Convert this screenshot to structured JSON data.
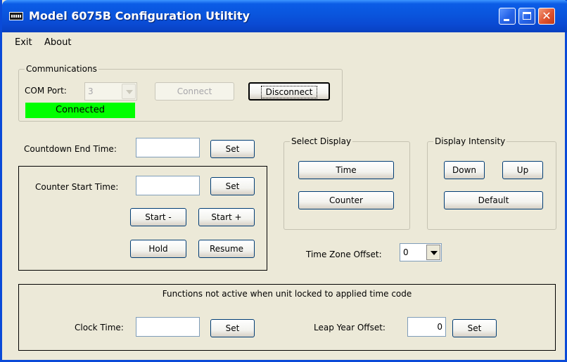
{
  "window": {
    "title": "Model 6075B Configuration Utiltity",
    "icon": "app-logo-icon"
  },
  "menu": {
    "items": [
      "Exit",
      "About"
    ]
  },
  "communications": {
    "group_label": "Communications",
    "com_port_label": "COM Port:",
    "com_port_value": "3",
    "connect_label": "Connect",
    "disconnect_label": "Disconnect",
    "status_text": "Connected",
    "status_color": "#00ff00"
  },
  "countdown": {
    "label": "Countdown End Time:",
    "value": "",
    "set_label": "Set"
  },
  "counter": {
    "label": "Counter Start Time:",
    "value": "",
    "set_label": "Set",
    "start_minus_label": "Start -",
    "start_plus_label": "Start +",
    "hold_label": "Hold",
    "resume_label": "Resume"
  },
  "select_display": {
    "group_label": "Select Display",
    "time_label": "Time",
    "counter_label": "Counter"
  },
  "display_intensity": {
    "group_label": "Display Intensity",
    "down_label": "Down",
    "up_label": "Up",
    "default_label": "Default"
  },
  "time_zone": {
    "label": "Time Zone Offset:",
    "value": "0"
  },
  "locked_functions": {
    "caption": "Functions not active when unit locked to applied time code",
    "clock_time_label": "Clock Time:",
    "clock_time_value": "",
    "clock_set_label": "Set",
    "leap_year_label": "Leap Year Offset:",
    "leap_year_value": "0",
    "leap_set_label": "Set"
  },
  "colors": {
    "titlebar": "#0a55dd",
    "close_button": "#e0522e",
    "window_bg": "#ece9d8",
    "status_ok": "#00ff00"
  }
}
